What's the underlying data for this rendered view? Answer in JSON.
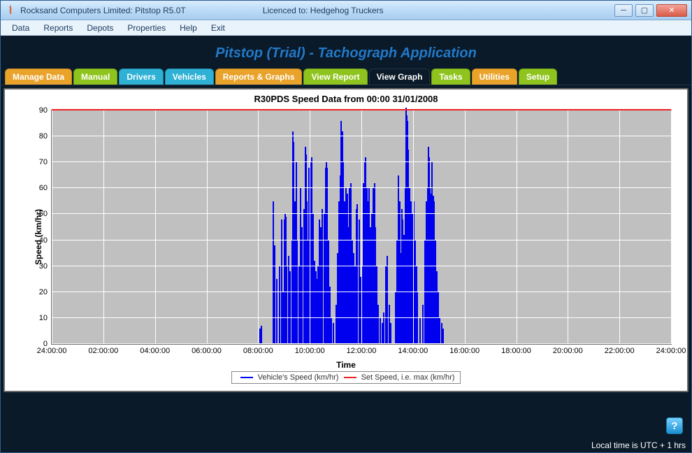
{
  "window": {
    "title": "Rocksand Computers Limited: Pitstop R5.0T",
    "licence": "Licenced to: Hedgehog Truckers"
  },
  "menu": [
    "Data",
    "Reports",
    "Depots",
    "Properties",
    "Help",
    "Exit"
  ],
  "app_title": "Pitstop (Trial) - Tachograph Application",
  "tabs": {
    "items": [
      {
        "label": "Manage Data",
        "color": "orange"
      },
      {
        "label": "Manual",
        "color": "green"
      },
      {
        "label": "Drivers",
        "color": "blue"
      },
      {
        "label": "Vehicles",
        "color": "blue"
      },
      {
        "label": "Reports & Graphs",
        "color": "orange"
      },
      {
        "label": "View Report",
        "color": "green"
      },
      {
        "label": "View Graph",
        "color": "active"
      },
      {
        "label": "Tasks",
        "color": "green"
      },
      {
        "label": "Utilities",
        "color": "orange"
      },
      {
        "label": "Setup",
        "color": "green"
      }
    ],
    "active_index": 6
  },
  "chart_data": {
    "type": "line",
    "title": "R30PDS Speed Data from 00:00 31/01/2008",
    "xlabel": "Time",
    "ylabel": "Speed (km/hr)",
    "ylim": [
      0,
      90
    ],
    "yticks": [
      0,
      10,
      20,
      30,
      40,
      50,
      60,
      70,
      80,
      90
    ],
    "x_range_hours": [
      0,
      24
    ],
    "xticks": [
      "24:00:00",
      "02:00:00",
      "04:00:00",
      "06:00:00",
      "08:00:00",
      "10:00:00",
      "12:00:00",
      "14:00:00",
      "16:00:00",
      "18:00:00",
      "20:00:00",
      "22:00:00",
      "24:00:00"
    ],
    "series": [
      {
        "name": "Vehicle's Speed (km/hr)",
        "color": "#0000ee",
        "spikes": [
          {
            "t": 8.05,
            "v": 6
          },
          {
            "t": 8.1,
            "v": 7
          },
          {
            "t": 8.55,
            "v": 55
          },
          {
            "t": 8.62,
            "v": 38
          },
          {
            "t": 8.7,
            "v": 25
          },
          {
            "t": 8.8,
            "v": 30
          },
          {
            "t": 8.88,
            "v": 48
          },
          {
            "t": 8.95,
            "v": 20
          },
          {
            "t": 9.0,
            "v": 48
          },
          {
            "t": 9.02,
            "v": 50
          },
          {
            "t": 9.05,
            "v": 49
          },
          {
            "t": 9.08,
            "v": 30
          },
          {
            "t": 9.15,
            "v": 34
          },
          {
            "t": 9.22,
            "v": 28
          },
          {
            "t": 9.3,
            "v": 40
          },
          {
            "t": 9.32,
            "v": 82
          },
          {
            "t": 9.35,
            "v": 78
          },
          {
            "t": 9.4,
            "v": 55
          },
          {
            "t": 9.45,
            "v": 70
          },
          {
            "t": 9.48,
            "v": 40
          },
          {
            "t": 9.55,
            "v": 30
          },
          {
            "t": 9.62,
            "v": 60
          },
          {
            "t": 9.68,
            "v": 45
          },
          {
            "t": 9.75,
            "v": 52
          },
          {
            "t": 9.8,
            "v": 76
          },
          {
            "t": 9.82,
            "v": 73
          },
          {
            "t": 9.85,
            "v": 55
          },
          {
            "t": 9.9,
            "v": 40
          },
          {
            "t": 9.95,
            "v": 68
          },
          {
            "t": 10.0,
            "v": 67
          },
          {
            "t": 10.03,
            "v": 70
          },
          {
            "t": 10.06,
            "v": 72
          },
          {
            "t": 10.1,
            "v": 50
          },
          {
            "t": 10.15,
            "v": 32
          },
          {
            "t": 10.2,
            "v": 28
          },
          {
            "t": 10.25,
            "v": 25
          },
          {
            "t": 10.3,
            "v": 30
          },
          {
            "t": 10.35,
            "v": 48
          },
          {
            "t": 10.4,
            "v": 45
          },
          {
            "t": 10.45,
            "v": 52
          },
          {
            "t": 10.55,
            "v": 50
          },
          {
            "t": 10.6,
            "v": 68
          },
          {
            "t": 10.62,
            "v": 70
          },
          {
            "t": 10.65,
            "v": 68
          },
          {
            "t": 10.7,
            "v": 40
          },
          {
            "t": 10.75,
            "v": 22
          },
          {
            "t": 10.8,
            "v": 10
          },
          {
            "t": 10.9,
            "v": 8
          },
          {
            "t": 11.0,
            "v": 15
          },
          {
            "t": 11.05,
            "v": 35
          },
          {
            "t": 11.1,
            "v": 55
          },
          {
            "t": 11.15,
            "v": 65
          },
          {
            "t": 11.18,
            "v": 86
          },
          {
            "t": 11.2,
            "v": 85
          },
          {
            "t": 11.25,
            "v": 82
          },
          {
            "t": 11.28,
            "v": 70
          },
          {
            "t": 11.32,
            "v": 55
          },
          {
            "t": 11.38,
            "v": 60
          },
          {
            "t": 11.42,
            "v": 58
          },
          {
            "t": 11.48,
            "v": 45
          },
          {
            "t": 11.52,
            "v": 60
          },
          {
            "t": 11.58,
            "v": 62
          },
          {
            "t": 11.62,
            "v": 40
          },
          {
            "t": 11.68,
            "v": 35
          },
          {
            "t": 11.72,
            "v": 30
          },
          {
            "t": 11.78,
            "v": 52
          },
          {
            "t": 11.82,
            "v": 54
          },
          {
            "t": 11.88,
            "v": 48
          },
          {
            "t": 11.95,
            "v": 26
          },
          {
            "t": 12.0,
            "v": 30
          },
          {
            "t": 12.05,
            "v": 62
          },
          {
            "t": 12.08,
            "v": 60
          },
          {
            "t": 12.1,
            "v": 70
          },
          {
            "t": 12.13,
            "v": 72
          },
          {
            "t": 12.18,
            "v": 60
          },
          {
            "t": 12.22,
            "v": 55
          },
          {
            "t": 12.28,
            "v": 60
          },
          {
            "t": 12.32,
            "v": 45
          },
          {
            "t": 12.38,
            "v": 50
          },
          {
            "t": 12.42,
            "v": 60
          },
          {
            "t": 12.48,
            "v": 62
          },
          {
            "t": 12.52,
            "v": 45
          },
          {
            "t": 12.58,
            "v": 30
          },
          {
            "t": 12.62,
            "v": 15
          },
          {
            "t": 12.7,
            "v": 10
          },
          {
            "t": 12.78,
            "v": 8
          },
          {
            "t": 12.85,
            "v": 12
          },
          {
            "t": 12.92,
            "v": 30
          },
          {
            "t": 12.98,
            "v": 34
          },
          {
            "t": 13.05,
            "v": 15
          },
          {
            "t": 13.12,
            "v": 8
          },
          {
            "t": 13.3,
            "v": 20
          },
          {
            "t": 13.35,
            "v": 40
          },
          {
            "t": 13.4,
            "v": 64
          },
          {
            "t": 13.42,
            "v": 65
          },
          {
            "t": 13.45,
            "v": 55
          },
          {
            "t": 13.5,
            "v": 35
          },
          {
            "t": 13.55,
            "v": 52
          },
          {
            "t": 13.58,
            "v": 48
          },
          {
            "t": 13.62,
            "v": 42
          },
          {
            "t": 13.68,
            "v": 60
          },
          {
            "t": 13.7,
            "v": 90
          },
          {
            "t": 13.71,
            "v": 91
          },
          {
            "t": 13.73,
            "v": 88
          },
          {
            "t": 13.76,
            "v": 86
          },
          {
            "t": 13.8,
            "v": 75
          },
          {
            "t": 13.85,
            "v": 60
          },
          {
            "t": 13.9,
            "v": 55
          },
          {
            "t": 13.95,
            "v": 50
          },
          {
            "t": 14.0,
            "v": 55
          },
          {
            "t": 14.05,
            "v": 40
          },
          {
            "t": 14.1,
            "v": 30
          },
          {
            "t": 14.15,
            "v": 20
          },
          {
            "t": 14.25,
            "v": 10
          },
          {
            "t": 14.35,
            "v": 15
          },
          {
            "t": 14.45,
            "v": 40
          },
          {
            "t": 14.48,
            "v": 55
          },
          {
            "t": 14.52,
            "v": 53
          },
          {
            "t": 14.55,
            "v": 60
          },
          {
            "t": 14.58,
            "v": 76
          },
          {
            "t": 14.6,
            "v": 72
          },
          {
            "t": 14.63,
            "v": 60
          },
          {
            "t": 14.68,
            "v": 58
          },
          {
            "t": 14.72,
            "v": 70
          },
          {
            "t": 14.75,
            "v": 57
          },
          {
            "t": 14.8,
            "v": 55
          },
          {
            "t": 14.85,
            "v": 40
          },
          {
            "t": 14.9,
            "v": 28
          },
          {
            "t": 14.95,
            "v": 20
          },
          {
            "t": 15.0,
            "v": 10
          },
          {
            "t": 15.08,
            "v": 8
          },
          {
            "t": 15.15,
            "v": 6
          }
        ]
      },
      {
        "name": "Set Speed, i.e. max (km/hr)",
        "color": "#ee2222",
        "constant": 90
      }
    ]
  },
  "legend": {
    "items": [
      {
        "swatch_color": "#0000ee",
        "label": "Vehicle's Speed (km/hr)"
      },
      {
        "swatch_color": "#ee2222",
        "label": "Set Speed, i.e. max (km/hr)"
      }
    ]
  },
  "statusbar": {
    "text": "Local time is UTC + 1 hrs"
  },
  "help_icon_label": "?"
}
